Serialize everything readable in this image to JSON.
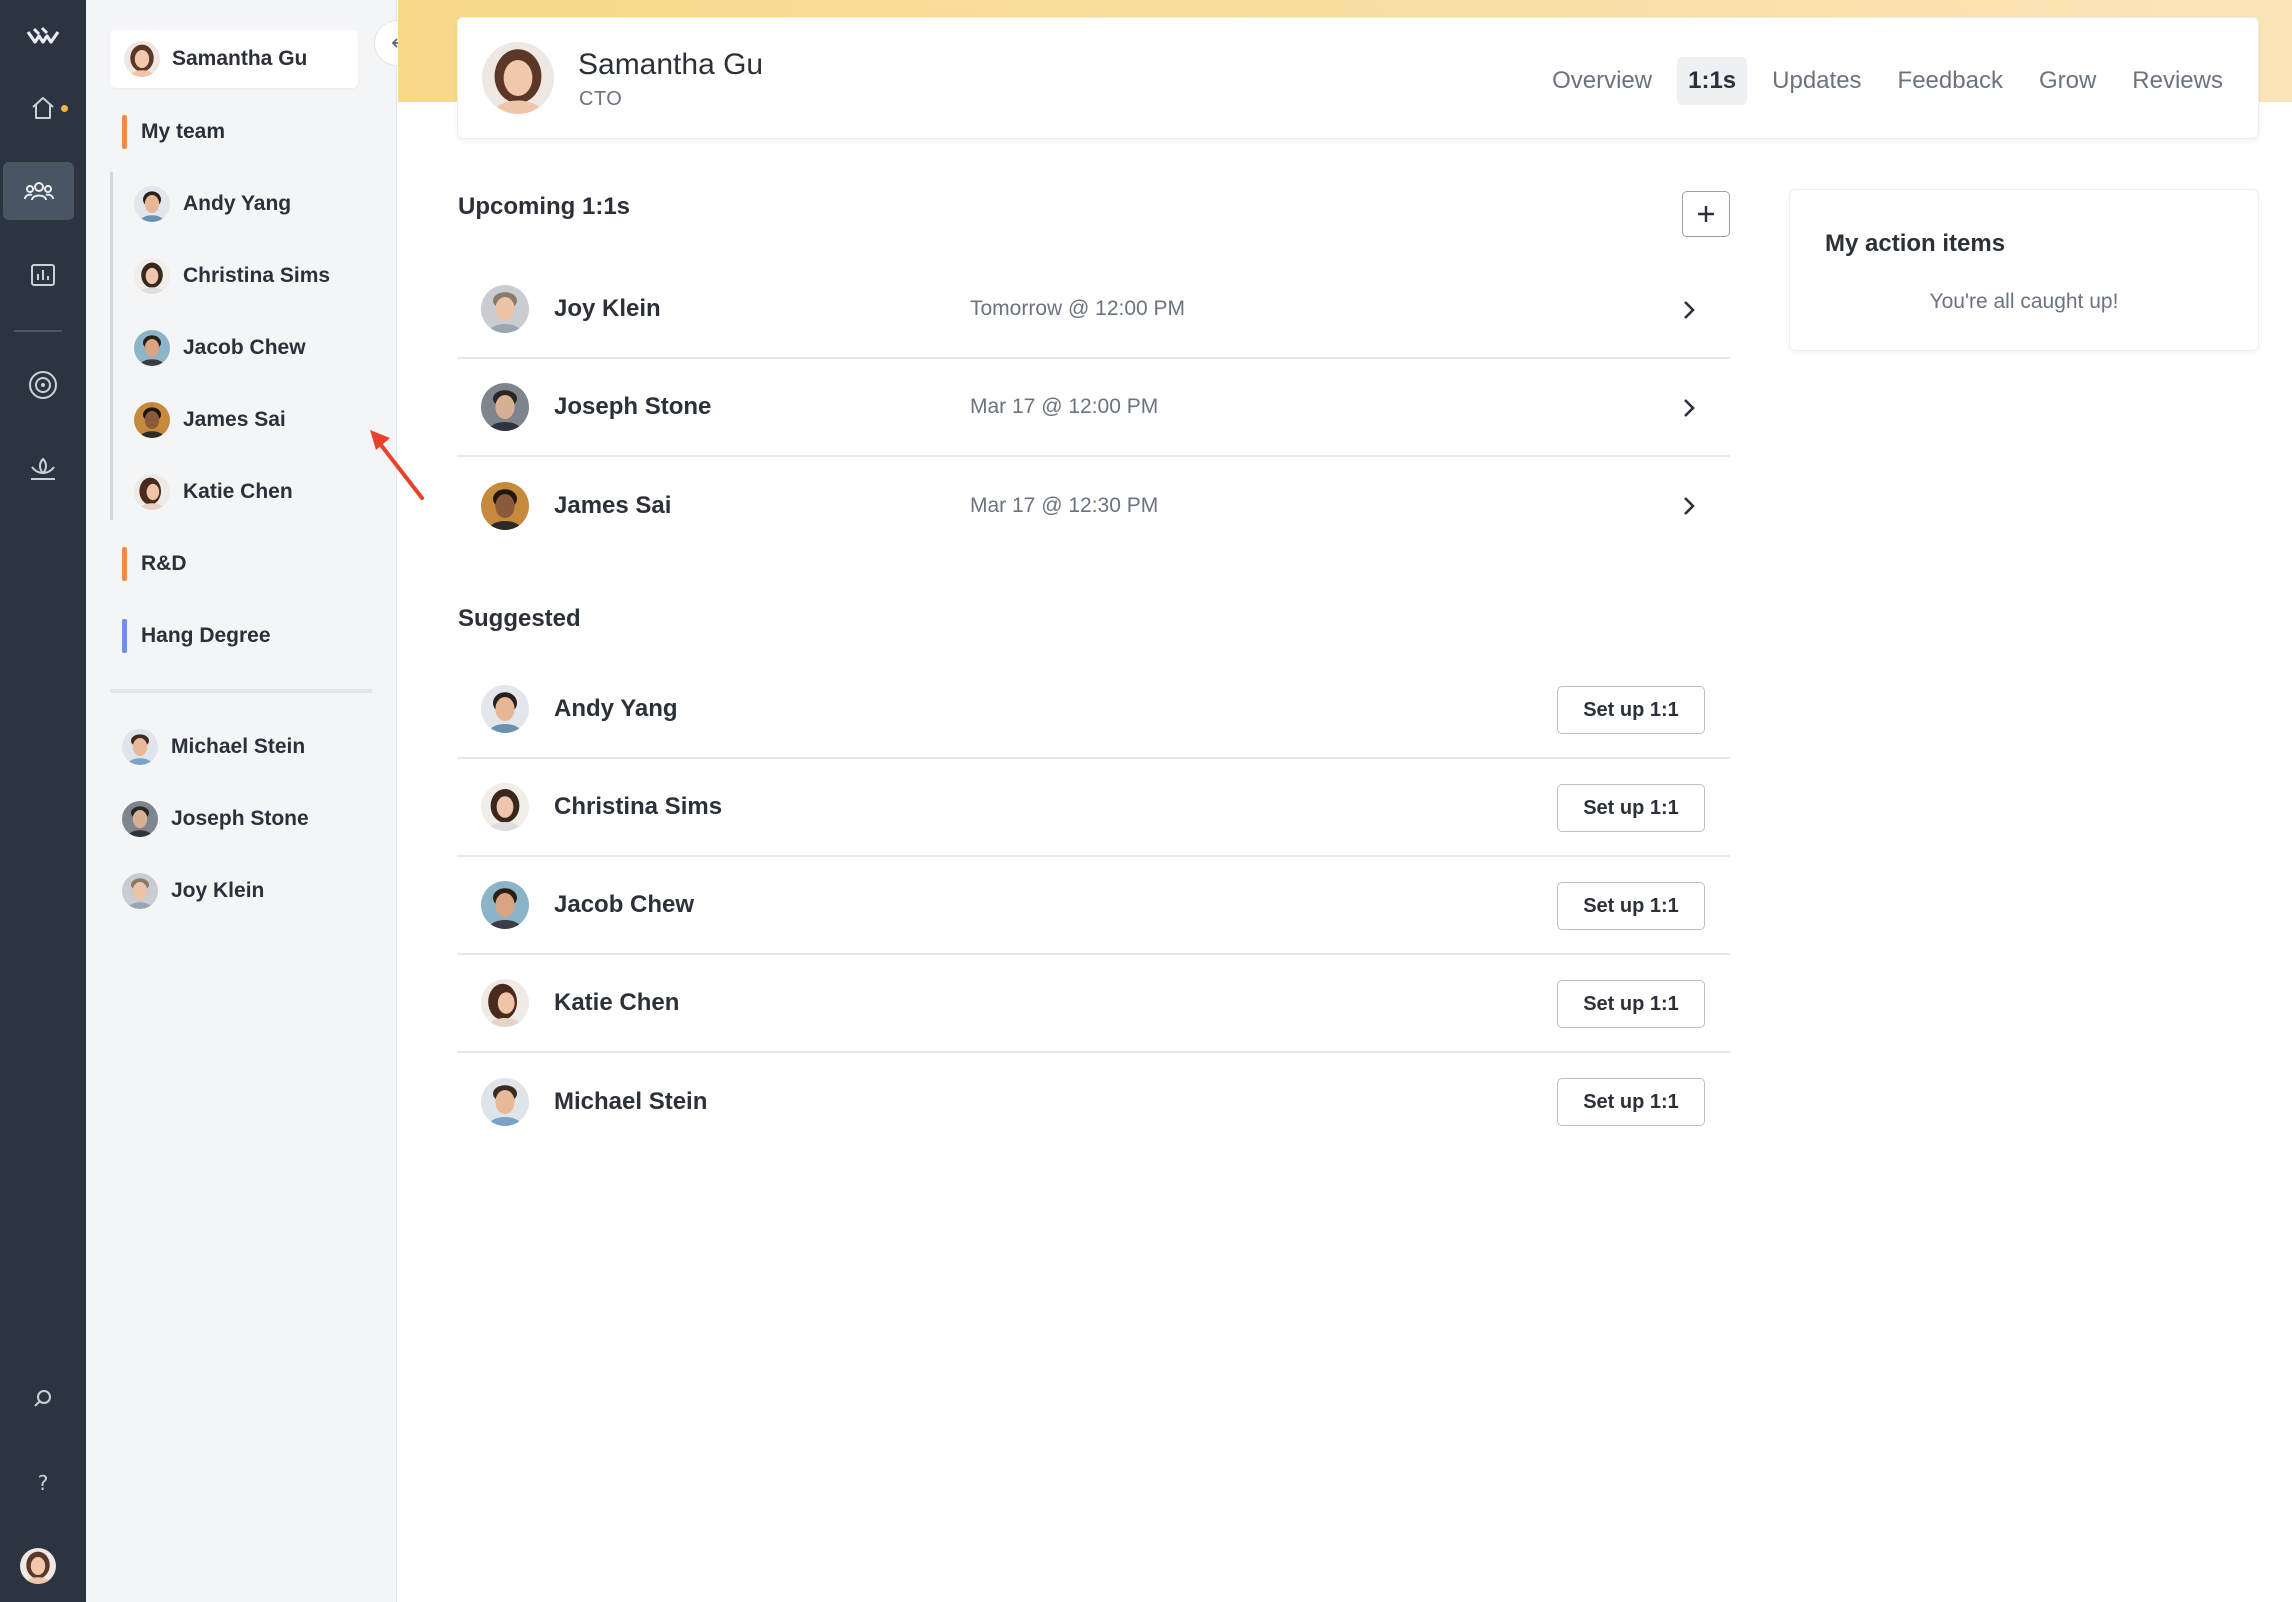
{
  "colors": {
    "rail_bg": "#2b3440",
    "accent_orange": "#f08a4b",
    "accent_blue": "#6e8fe6",
    "notification_dot": "#f4b43d",
    "annotation_arrow": "#e8422c"
  },
  "rail": {
    "items": [
      {
        "icon": "logo-icon"
      },
      {
        "icon": "home-icon"
      },
      {
        "icon": "team-icon"
      },
      {
        "icon": "chart-icon"
      },
      {
        "icon": "target-icon"
      },
      {
        "icon": "growth-icon"
      },
      {
        "icon": "search-icon"
      },
      {
        "icon": "help-icon"
      }
    ]
  },
  "sidebar": {
    "current_user": "Samantha Gu",
    "collapse_icon": "collapse-left-icon",
    "groups": {
      "my_team": "My team",
      "rnd": "R&D",
      "hang": "Hang Degree"
    },
    "team_members": [
      {
        "name": "Andy Yang"
      },
      {
        "name": "Christina Sims"
      },
      {
        "name": "Jacob Chew"
      },
      {
        "name": "James Sai"
      },
      {
        "name": "Katie Chen"
      }
    ],
    "others": [
      {
        "name": "Michael Stein"
      },
      {
        "name": "Joseph Stone"
      },
      {
        "name": "Joy Klein"
      }
    ]
  },
  "header": {
    "name": "Samantha Gu",
    "role": "CTO",
    "tabs": [
      "Overview",
      "1:1s",
      "Updates",
      "Feedback",
      "Grow",
      "Reviews"
    ],
    "active_tab": "1:1s"
  },
  "upcoming": {
    "title": "Upcoming 1:1s",
    "items": [
      {
        "name": "Joy Klein",
        "when": "Tomorrow @ 12:00 PM"
      },
      {
        "name": "Joseph Stone",
        "when": "Mar 17 @ 12:00 PM"
      },
      {
        "name": "James Sai",
        "when": "Mar 17 @ 12:30 PM"
      }
    ]
  },
  "suggested": {
    "title": "Suggested",
    "button_label": "Set up 1:1",
    "items": [
      {
        "name": "Andy Yang"
      },
      {
        "name": "Christina Sims"
      },
      {
        "name": "Jacob Chew"
      },
      {
        "name": "Katie Chen"
      },
      {
        "name": "Michael Stein"
      }
    ]
  },
  "action_items": {
    "title": "My action items",
    "message": "You're all caught up!"
  }
}
